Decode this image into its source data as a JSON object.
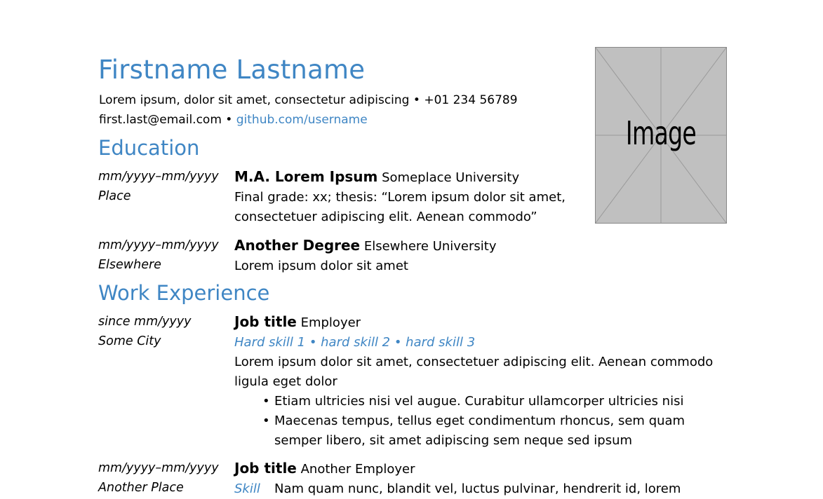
{
  "header": {
    "name": "Firstname Lastname",
    "address": "Lorem ipsum, dolor sit amet, consectetur adipiscing",
    "phone": "+01 234 56789",
    "email": "first.last@email.com",
    "github": "github.com/username",
    "separator": "•"
  },
  "photo": {
    "label": "Image"
  },
  "education": {
    "title": "Education",
    "entries": [
      {
        "dates": "mm/yyyy–mm/yyyy",
        "place": "Place",
        "degree": "M.A. Lorem Ipsum",
        "institution": "Someplace University",
        "details": [
          "Final grade: xx; thesis: “Lorem ipsum dolor sit amet,",
          "consectetuer adipiscing elit. Aenean commodo”"
        ]
      },
      {
        "dates": "mm/yyyy–mm/yyyy",
        "place": "Elsewhere",
        "degree": "Another Degree",
        "institution": "Elsewhere University",
        "details": [
          "Lorem ipsum dolor sit amet"
        ]
      }
    ]
  },
  "work": {
    "title": "Work Experience",
    "entries": [
      {
        "dates": "since mm/yyyy",
        "place": "Some City",
        "job_title": "Job title",
        "employer": "Employer",
        "skills": "Hard skill 1 • hard skill 2 • hard skill 3",
        "description": [
          "Lorem ipsum dolor sit amet, consectetuer adipiscing elit. Aenean commodo",
          "ligula eget dolor"
        ],
        "bullets": [
          [
            "Etiam ultricies nisi vel augue. Curabitur ullamcorper ultricies nisi"
          ],
          [
            "Maecenas tempus, tellus eget condimentum rhoncus, sem quam",
            "semper libero, sit amet adipiscing sem neque sed ipsum"
          ]
        ]
      },
      {
        "dates": "mm/yyyy–mm/yyyy",
        "place": "Another Place",
        "job_title": "Job title",
        "employer": "Another Employer",
        "skill_tag": "Skill",
        "skill_text": "Nam quam nunc, blandit vel, luctus pulvinar, hendrerit id, lorem"
      }
    ]
  },
  "colors": {
    "accent": "#3f86c4",
    "photo_bg": "#c0c0c0"
  }
}
